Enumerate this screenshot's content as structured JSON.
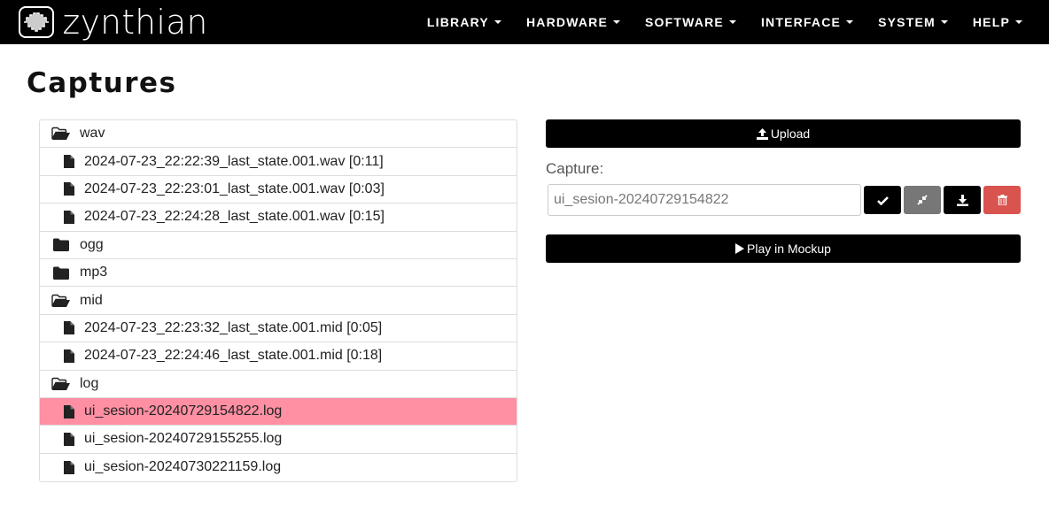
{
  "navbar": {
    "brand": "zynthian",
    "menu": [
      {
        "label": "LIBRARY"
      },
      {
        "label": "HARDWARE"
      },
      {
        "label": "SOFTWARE"
      },
      {
        "label": "INTERFACE"
      },
      {
        "label": "SYSTEM"
      },
      {
        "label": "HELP"
      }
    ]
  },
  "page": {
    "title": "Captures"
  },
  "tree": {
    "rows": [
      {
        "label": "wav",
        "kind": "folder-open"
      },
      {
        "label": "2024-07-23_22:22:39_last_state.001.wav [0:11]",
        "kind": "file"
      },
      {
        "label": "2024-07-23_22:23:01_last_state.001.wav [0:03]",
        "kind": "file"
      },
      {
        "label": "2024-07-23_22:24:28_last_state.001.wav [0:15]",
        "kind": "file"
      },
      {
        "label": "ogg",
        "kind": "folder-closed"
      },
      {
        "label": "mp3",
        "kind": "folder-closed"
      },
      {
        "label": "mid",
        "kind": "folder-open"
      },
      {
        "label": "2024-07-23_22:23:32_last_state.001.mid [0:05]",
        "kind": "file"
      },
      {
        "label": "2024-07-23_22:24:46_last_state.001.mid [0:18]",
        "kind": "file"
      },
      {
        "label": "log",
        "kind": "folder-open"
      },
      {
        "label": "ui_sesion-20240729154822.log",
        "kind": "file",
        "selected": true
      },
      {
        "label": "ui_sesion-20240729155255.log",
        "kind": "file"
      },
      {
        "label": "ui_sesion-20240730221159.log",
        "kind": "file"
      }
    ]
  },
  "panel": {
    "upload_label": "Upload",
    "capture_label": "Capture:",
    "capture_value": "ui_sesion-20240729154822",
    "play_label": "Play in Mockup",
    "actions": [
      {
        "icon": "check-icon",
        "color": "#000000"
      },
      {
        "icon": "compress-icon",
        "color": "#777777"
      },
      {
        "icon": "download-icon",
        "color": "#000000"
      },
      {
        "icon": "trash-icon",
        "color": "#d9534f"
      }
    ]
  },
  "colors": {
    "navbar": "#000000",
    "selected_row": "#ff8fa3",
    "danger": "#d9534f"
  }
}
